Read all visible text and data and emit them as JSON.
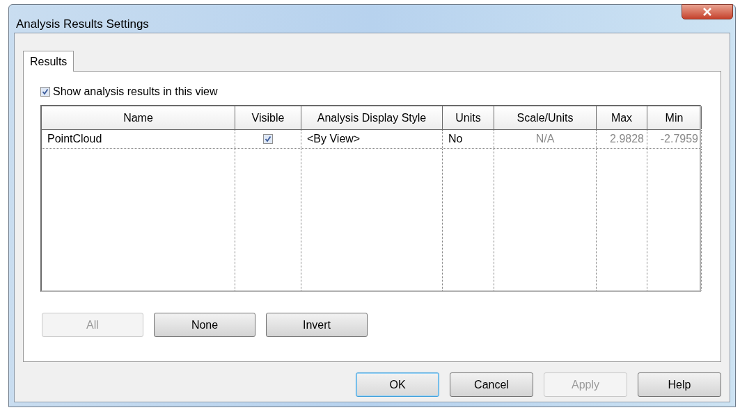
{
  "window": {
    "title": "Analysis Results Settings"
  },
  "tabs": [
    {
      "label": "Results",
      "selected": true
    }
  ],
  "show_results": {
    "label": "Show analysis results in this view",
    "checked": true
  },
  "table": {
    "columns": [
      {
        "label": "Name",
        "readonly": false
      },
      {
        "label": "Visible",
        "readonly": false
      },
      {
        "label": "Analysis Display Style",
        "readonly": false
      },
      {
        "label": "Units",
        "readonly": false
      },
      {
        "label": "Scale/Units",
        "readonly": true
      },
      {
        "label": "Max",
        "readonly": true
      },
      {
        "label": "Min",
        "readonly": true
      }
    ],
    "rows": [
      {
        "name": "PointCloud",
        "visible": true,
        "style": "<By View>",
        "units": "No",
        "scale": "N/A",
        "max": "2.9828",
        "min": "-2.7959"
      }
    ]
  },
  "row_buttons": [
    {
      "label": "All",
      "disabled": true
    },
    {
      "label": "None",
      "disabled": false
    },
    {
      "label": "Invert",
      "disabled": false
    }
  ],
  "dialog_buttons": [
    {
      "label": "OK",
      "disabled": false,
      "default": true
    },
    {
      "label": "Cancel",
      "disabled": false,
      "default": false
    },
    {
      "label": "Apply",
      "disabled": true,
      "default": false
    },
    {
      "label": "Help",
      "disabled": false,
      "default": false
    }
  ]
}
